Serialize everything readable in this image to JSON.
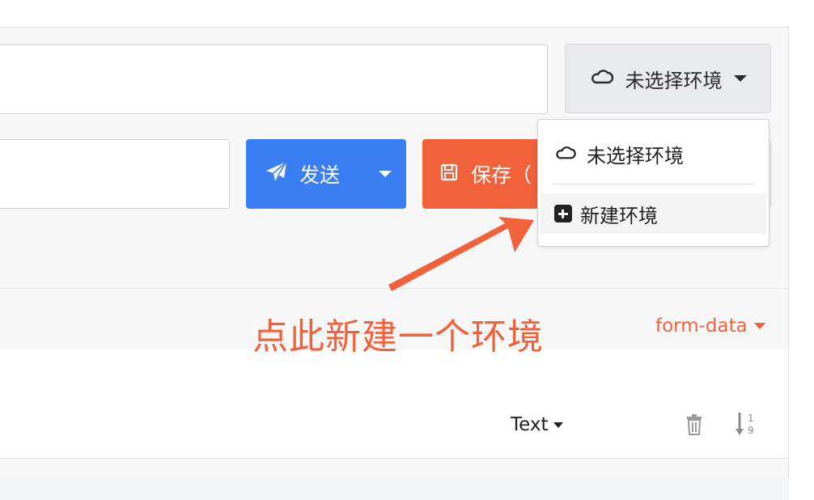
{
  "environment": {
    "button_label": "未选择环境",
    "dropdown": {
      "item_none": "未选择环境",
      "item_new": "新建环境"
    }
  },
  "send": {
    "label": "发送"
  },
  "save": {
    "label": "保存（"
  },
  "body": {
    "format_label": "form-data",
    "type_select": "Text"
  },
  "annotation": {
    "text": "点此新建一个环境"
  },
  "colors": {
    "primary_blue": "#3a7ef4",
    "accent_orange": "#f1623a"
  }
}
